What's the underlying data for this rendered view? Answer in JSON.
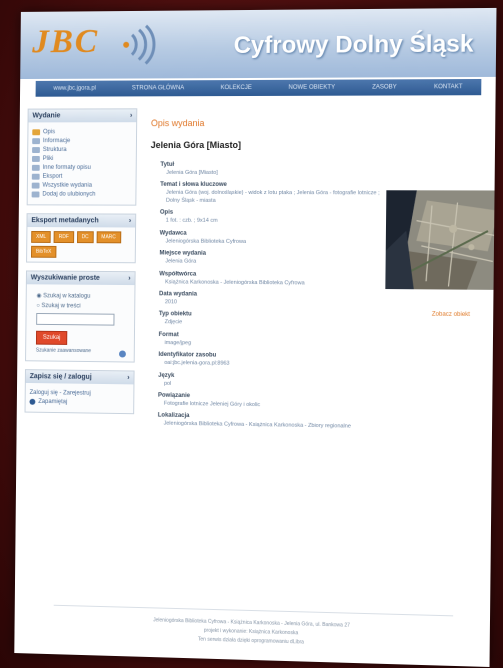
{
  "header": {
    "logo": "JBC",
    "title": "Cyfrowy Dolny Śląsk"
  },
  "nav": {
    "items": [
      "www.jbc.jgora.pl",
      "STRONA GŁÓWNA",
      "KOLEKCJE",
      "NOWE OBIEKTY",
      "ZASOBY",
      "KONTAKT"
    ]
  },
  "sidebar": {
    "wydanie": {
      "title": "Wydanie",
      "items": [
        "Opis",
        "Informacje",
        "Struktura",
        "Pliki",
        "Inne formaty opisu",
        "Eksport",
        "Wszystkie wydania",
        "Dodaj do ulubionych"
      ]
    },
    "tags": {
      "title": "Eksport metadanych",
      "items": [
        "XML",
        "RDF",
        "DC",
        "MARC",
        "BibTeX"
      ]
    },
    "search": {
      "title": "Wyszukiwanie proste",
      "option_1": "Szukaj w katalogu",
      "option_2": "Szukaj w treści",
      "button": "Szukaj",
      "link": "Szukanie zaawansowane"
    },
    "login": {
      "title": "Zapisz się / zaloguj",
      "text": "Zaloguj się - Zarejestruj",
      "link": "Zapamiętaj"
    }
  },
  "main": {
    "section_title": "Opis wydania",
    "record_title": "Jelenia Góra [Miasto]",
    "thumb_link": "Zobacz obiekt",
    "fields": [
      {
        "label": "Tytuł",
        "value": "Jelenia Góra [Miasto]"
      },
      {
        "label": "Temat i słowa kluczowe",
        "value": "Jelenia Góra (woj. dolnośląskie) - widok z lotu ptaka ; Jelenia Góra - fotografie lotnicze ; Dolny Śląsk - miasta"
      },
      {
        "label": "Opis",
        "value": "1 fot. : czb. ; 9x14 cm"
      },
      {
        "label": "Wydawca",
        "value": "Jeleniogórska Biblioteka Cyfrowa"
      },
      {
        "label": "Miejsce wydania",
        "value": "Jelenia Góra"
      },
      {
        "label": "Współtwórca",
        "value": "Książnica Karkonoska - Jeleniogórska Biblioteka Cyfrowa"
      },
      {
        "label": "Data wydania",
        "value": "2010"
      },
      {
        "label": "Typ obiektu",
        "value": "Zdjęcie"
      },
      {
        "label": "Format",
        "value": "image/jpeg"
      },
      {
        "label": "Identyfikator zasobu",
        "value": "oai:jbc.jelenia-gora.pl:8963"
      },
      {
        "label": "Język",
        "value": "pol"
      },
      {
        "label": "Powiązanie",
        "value": "Fotografie lotnicze Jeleniej Góry i okolic"
      },
      {
        "label": "Lokalizacja",
        "value": "Jeleniogórska Biblioteka Cyfrowa - Książnica Karkonoska - Zbiory regionalne"
      }
    ]
  },
  "footer": {
    "line1": "Jeleniogórska Biblioteka Cyfrowa - Książnica Karkonoska - Jelenia Góra, ul. Bankowa 27",
    "line2": "projekt i wykonanie: Książnica Karkonoska",
    "line3": "Ten serwis działa dzięki oprogramowaniu dLibra"
  },
  "colors": {
    "background": "#4a0d0d",
    "banner": "#b7cbe3",
    "nav": "#2e5a92",
    "accent": "#e0782a"
  }
}
